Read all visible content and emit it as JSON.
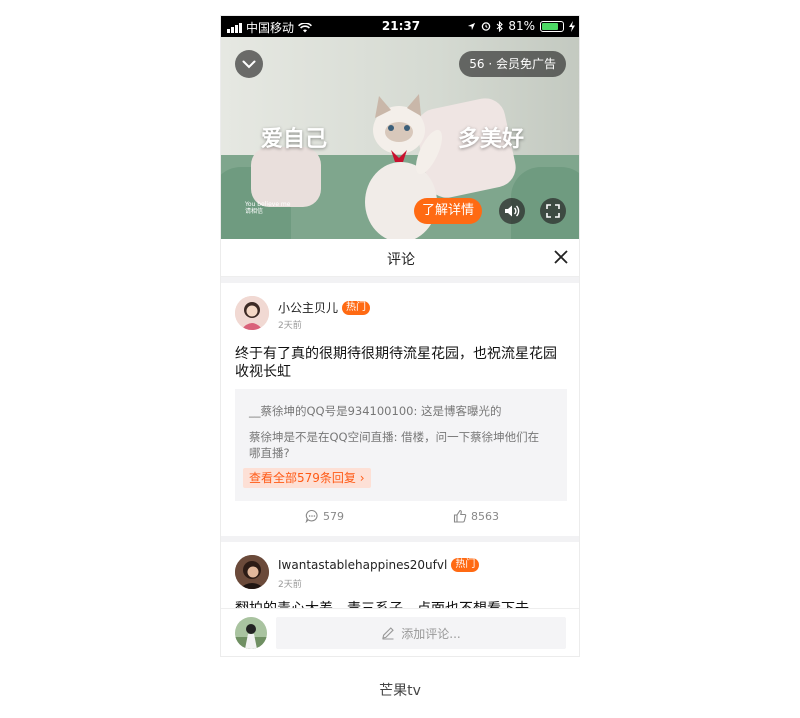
{
  "status_bar": {
    "carrier": "中国移动",
    "time": "21:37",
    "battery": "81%"
  },
  "video": {
    "ad_badge": "56 · 会员免广告",
    "overlay_left": "爱自己",
    "overlay_right": "多美好",
    "watermark_line1": "You believe me",
    "watermark_line2": "请相信",
    "learn_more": "了解详情"
  },
  "comments_panel": {
    "title": "评论",
    "comments": [
      {
        "username": "小公主贝儿",
        "badge": "热门",
        "time": "2天前",
        "text": "终于有了真的很期待很期待流星花园，也祝流星花园收视长虹",
        "replies": [
          "__蔡徐坤的QQ号是934100100: 这是博客曝光的",
          "蔡徐坤是不是在QQ空间直播: 借楼，问一下蔡徐坤他们在哪直播?"
        ],
        "view_all": "查看全部579条回复",
        "comment_count": "579",
        "like_count": "8563"
      },
      {
        "username": "Iwantastablehappines20ufvl",
        "badge": "热门",
        "time": "2天前",
        "text": "翻拍的毒心大差，责三系子，点面也不想看下去"
      }
    ],
    "input_placeholder": "添加评论..."
  },
  "caption": "芒果tv",
  "colors": {
    "accent": "#ff6a13",
    "view_all_bg": "#fde0d6"
  }
}
